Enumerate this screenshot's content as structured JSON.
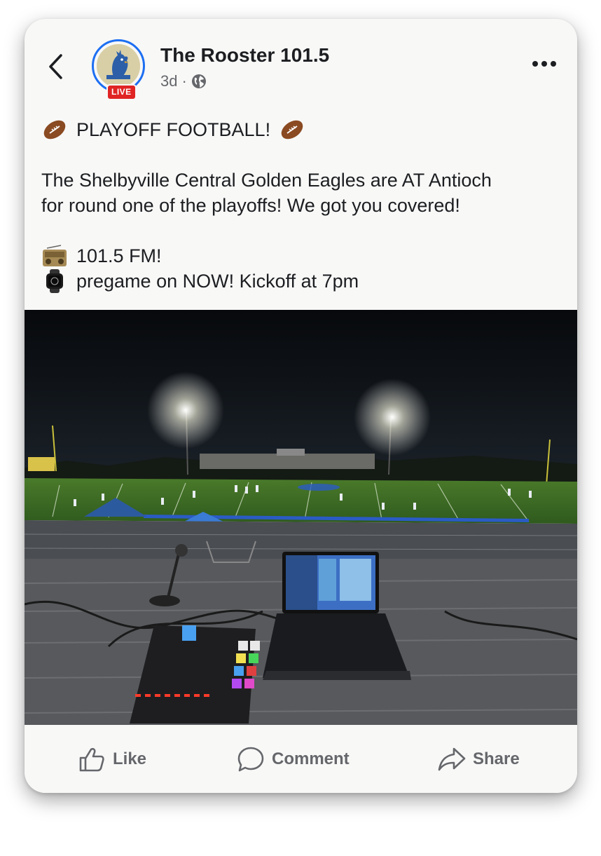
{
  "post": {
    "page_name": "The Rooster 101.5",
    "live_badge": "LIVE",
    "time_ago": "3d",
    "separator": "·",
    "audience_icon": "globe-icon",
    "more_icon": "more-horizontal-icon",
    "back_icon": "chevron-left-icon"
  },
  "content": {
    "headline": "PLAYOFF FOOTBALL!",
    "headline_emoji": "football-emoji",
    "body_line1": "The Shelbyville Central Golden Eagles are AT Antioch",
    "body_line2": "for round one of the playoffs! We got you covered!",
    "radio_line": "101.5 FM!",
    "radio_emoji": "radio-emoji",
    "watch_line": "pregame on NOW! Kickoff at 7pm",
    "watch_emoji": "watch-emoji"
  },
  "actions": {
    "like_label": "Like",
    "comment_label": "Comment",
    "share_label": "Share"
  },
  "colors": {
    "accent": "#1d6ff2",
    "live": "#e02424",
    "text": "#1c1e21",
    "muted": "#65676b"
  }
}
